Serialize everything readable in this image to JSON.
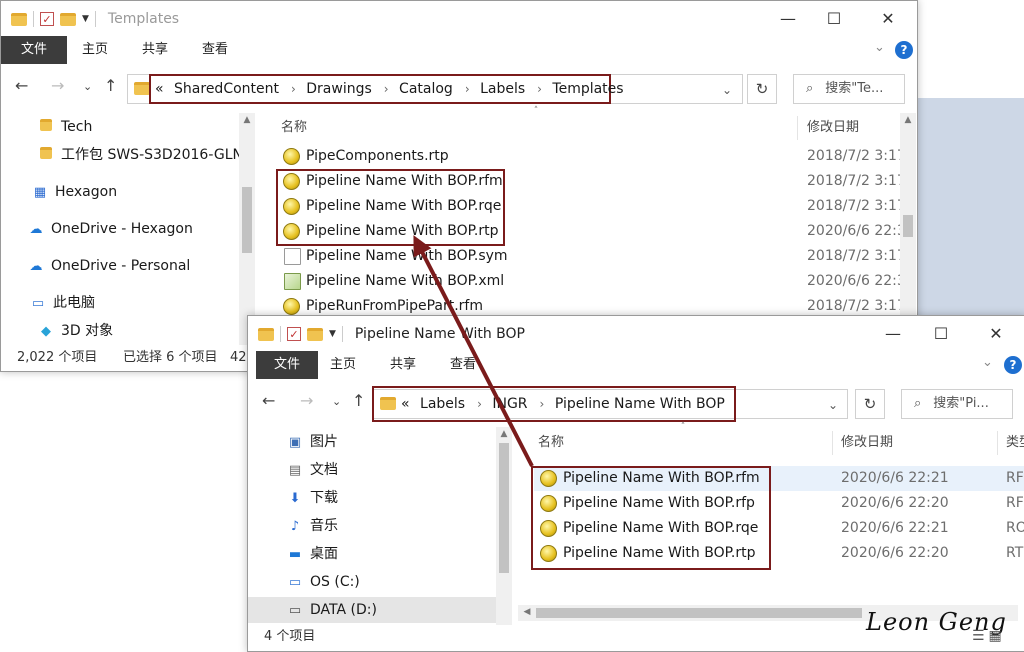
{
  "ribbon_tabs": {
    "file": "文件",
    "home": "主页",
    "share": "共享",
    "view": "查看"
  },
  "window_controls": {
    "minimize": "—",
    "maximize": "☐",
    "close": "✕"
  },
  "win1": {
    "title": "Templates",
    "address": {
      "prefix": "«",
      "segments": [
        "SharedContent",
        "Drawings",
        "Catalog",
        "Labels",
        "Templates"
      ]
    },
    "search_placeholder": "搜索\"Te...",
    "nav_items": [
      {
        "label": "Tech",
        "icon": "folder-icon"
      },
      {
        "label": "工作包 SWS-S3D2016-GLN",
        "icon": "folder-icon"
      },
      {
        "label": "Hexagon",
        "icon": "building-icon"
      },
      {
        "label": "OneDrive - Hexagon",
        "icon": "cloud-icon"
      },
      {
        "label": "OneDrive - Personal",
        "icon": "cloud-icon"
      },
      {
        "label": "此电脑",
        "icon": "computer-icon"
      },
      {
        "label": "3D 对象",
        "icon": "cube-icon"
      }
    ],
    "columns": {
      "name": "名称",
      "date": "修改日期"
    },
    "files": [
      {
        "name": "PipeComponents.rtp",
        "date": "2018/7/2 3:17",
        "icon": "label-file-icon"
      },
      {
        "name": "Pipeline Name With BOP.rfm",
        "date": "2018/7/2 3:17",
        "icon": "label-file-icon"
      },
      {
        "name": "Pipeline Name With BOP.rqe",
        "date": "2018/7/2 3:17",
        "icon": "label-file-icon"
      },
      {
        "name": "Pipeline Name With BOP.rtp",
        "date": "2020/6/6 22:3",
        "icon": "label-file-icon"
      },
      {
        "name": "Pipeline Name With BOP.sym",
        "date": "2018/7/2 3:17",
        "icon": "document-icon"
      },
      {
        "name": "Pipeline Name With BOP.xml",
        "date": "2020/6/6 22:3",
        "icon": "xml-file-icon"
      },
      {
        "name": "PipeRunFromPipePart.rfm",
        "date": "2018/7/2 3:17",
        "icon": "label-file-icon"
      }
    ],
    "status": {
      "count": "2,022 个项目",
      "selected": "已选择 6 个项目",
      "size": "42."
    }
  },
  "win2": {
    "title": "Pipeline Name With BOP",
    "address": {
      "prefix": "«",
      "segments": [
        "Labels",
        "INGR",
        "Pipeline Name With BOP"
      ]
    },
    "search_placeholder": "搜索\"Pi...",
    "nav_items": [
      {
        "label": "图片",
        "icon": "pictures-icon"
      },
      {
        "label": "文档",
        "icon": "documents-icon"
      },
      {
        "label": "下载",
        "icon": "download-icon"
      },
      {
        "label": "音乐",
        "icon": "music-icon"
      },
      {
        "label": "桌面",
        "icon": "desktop-icon"
      },
      {
        "label": "OS (C:)",
        "icon": "drive-icon"
      },
      {
        "label": "DATA (D:)",
        "icon": "drive-icon"
      }
    ],
    "columns": {
      "name": "名称",
      "date": "修改日期",
      "type": "类型"
    },
    "files": [
      {
        "name": "Pipeline Name With BOP.rfm",
        "date": "2020/6/6 22:21",
        "type": "RF"
      },
      {
        "name": "Pipeline Name With BOP.rfp",
        "date": "2020/6/6 22:20",
        "type": "RF"
      },
      {
        "name": "Pipeline Name With BOP.rqe",
        "date": "2020/6/6 22:21",
        "type": "RO"
      },
      {
        "name": "Pipeline Name With BOP.rtp",
        "date": "2020/6/6 22:20",
        "type": "RT"
      }
    ],
    "status": {
      "count": "4 个项目"
    }
  },
  "watermark": "Leon Geng",
  "accent_colors": {
    "highlight_frame": "#7a1b1b",
    "help_button": "#1e6fd0",
    "folder": "#f0c350"
  }
}
